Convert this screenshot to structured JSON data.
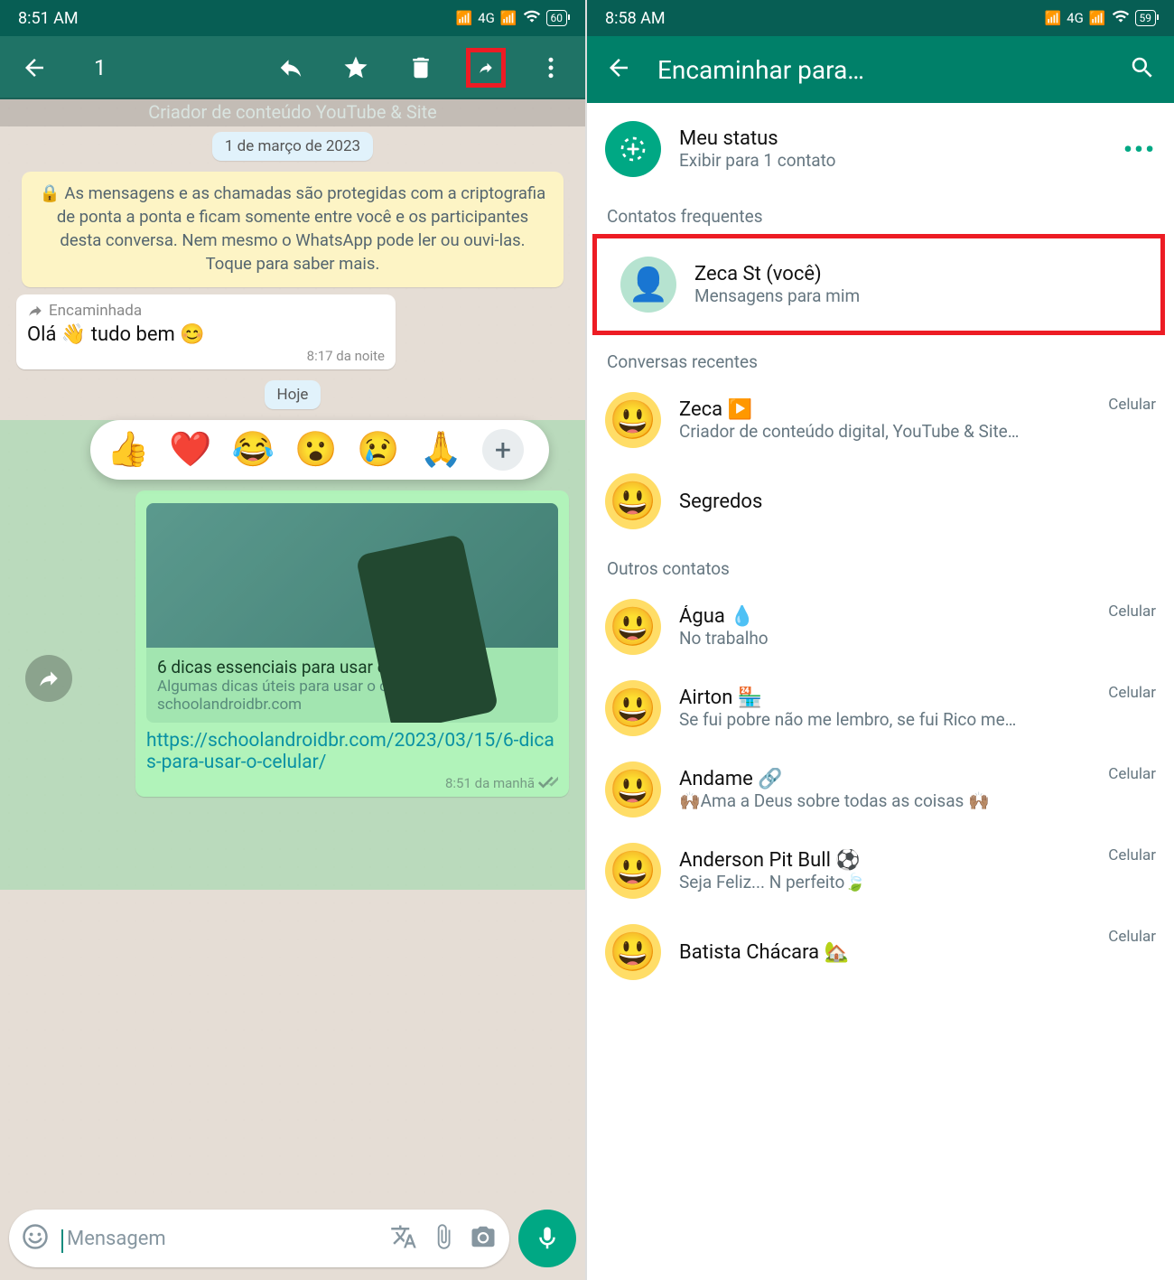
{
  "left": {
    "status_time": "8:51 AM",
    "signal_text": "4G",
    "battery": "60",
    "count": "1",
    "subtitle": "Criador de conteúdo YouTube & Site",
    "date1": "1 de março de 2023",
    "encryption": "🔒 As mensagens e as chamadas são protegidas com a criptografia de ponta a ponta e ficam somente entre você e os participantes desta conversa. Nem mesmo o WhatsApp pode ler ou ouvi-las. Toque para saber mais.",
    "fwd_label": "Encaminhada",
    "msg1_text": "Olá 👋 tudo bem 😊",
    "msg1_time": "8:17 da noite",
    "date2": "Hoje",
    "reactions": [
      "👍",
      "❤️",
      "😂",
      "😮",
      "😢",
      "🙏"
    ],
    "preview_title": "6 dicas essenciais para usar o celular",
    "preview_desc": "Algumas dicas úteis para usar o celular. As dic…",
    "preview_domain": "schoolandroidbr.com",
    "link_text": "https://schoolandroidbr.com/2023/03/15/6-dicas-para-usar-o-celular/",
    "msg2_time": "8:51 da manhã",
    "input_placeholder": "Mensagem"
  },
  "right": {
    "status_time": "8:58 AM",
    "signal_text": "4G",
    "battery": "59",
    "title": "Encaminhar para…",
    "my_status_title": "Meu status",
    "my_status_sub": "Exibir para 1 contato",
    "section_freq": "Contatos frequentes",
    "section_recent": "Conversas recentes",
    "section_other": "Outros contatos",
    "tag_mobile": "Celular",
    "contacts_freq": {
      "name": "Zeca St (você)",
      "sub": "Mensagens para mim"
    },
    "contacts_recent": [
      {
        "name": "Zeca ▶️",
        "sub": "Criador de conteúdo digital, YouTube & Site…",
        "tag": "Celular"
      },
      {
        "name": "Segredos",
        "sub": ""
      }
    ],
    "contacts_other": [
      {
        "name": "Água 💧",
        "sub": "No trabalho",
        "tag": "Celular"
      },
      {
        "name": "Airton 🏪",
        "sub": "Se fui pobre não me lembro, se fui Rico me…",
        "tag": "Celular"
      },
      {
        "name": "Andame 🔗",
        "sub": "🙌🏽Ama a Deus sobre todas as coisas 🙌🏽",
        "tag": "Celular"
      },
      {
        "name": "Anderson Pit Bull ⚽",
        "sub": "Seja Feliz... N perfeito🍃",
        "tag": "Celular"
      },
      {
        "name": "Batista Chácara 🏡",
        "sub": "",
        "tag": "Celular"
      }
    ]
  }
}
